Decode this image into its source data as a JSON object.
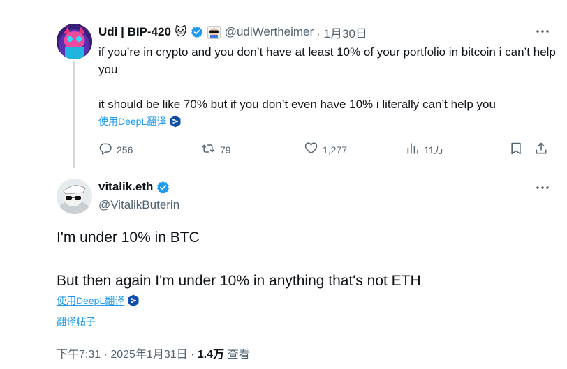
{
  "parent_tweet": {
    "name": "Udi | BIP-420",
    "name_emoji": "🐱",
    "handle": "@udiWertheimer",
    "date": "· 1月30日",
    "text_line1": "if you’re in crypto and you don’t have at least 10% of your portfolio in bitcoin i can’t help you",
    "text_line2": "it should be like 70% but if you don’t even have 10% i literally can’t help you",
    "translate_label": "使用DeepL翻译",
    "replies": "256",
    "reposts": "79",
    "likes": "1,277",
    "views": "11万"
  },
  "main_tweet": {
    "name": "vitalik.eth",
    "handle": "@VitalikButerin",
    "text_line1": "I'm under 10% in BTC",
    "text_line2": "But then again I'm under 10% in anything that's not ETH",
    "translate_label": "使用DeepL翻译",
    "translate_post_label": "翻译帖子",
    "time": "下午7:31 · 2025年1月31日 · ",
    "views_count": "1.4万",
    "views_label": " 查看"
  },
  "colors": {
    "verified_blue": "#1d9bf0",
    "link_blue": "#1d9bf0",
    "secondary_text": "#536471"
  }
}
